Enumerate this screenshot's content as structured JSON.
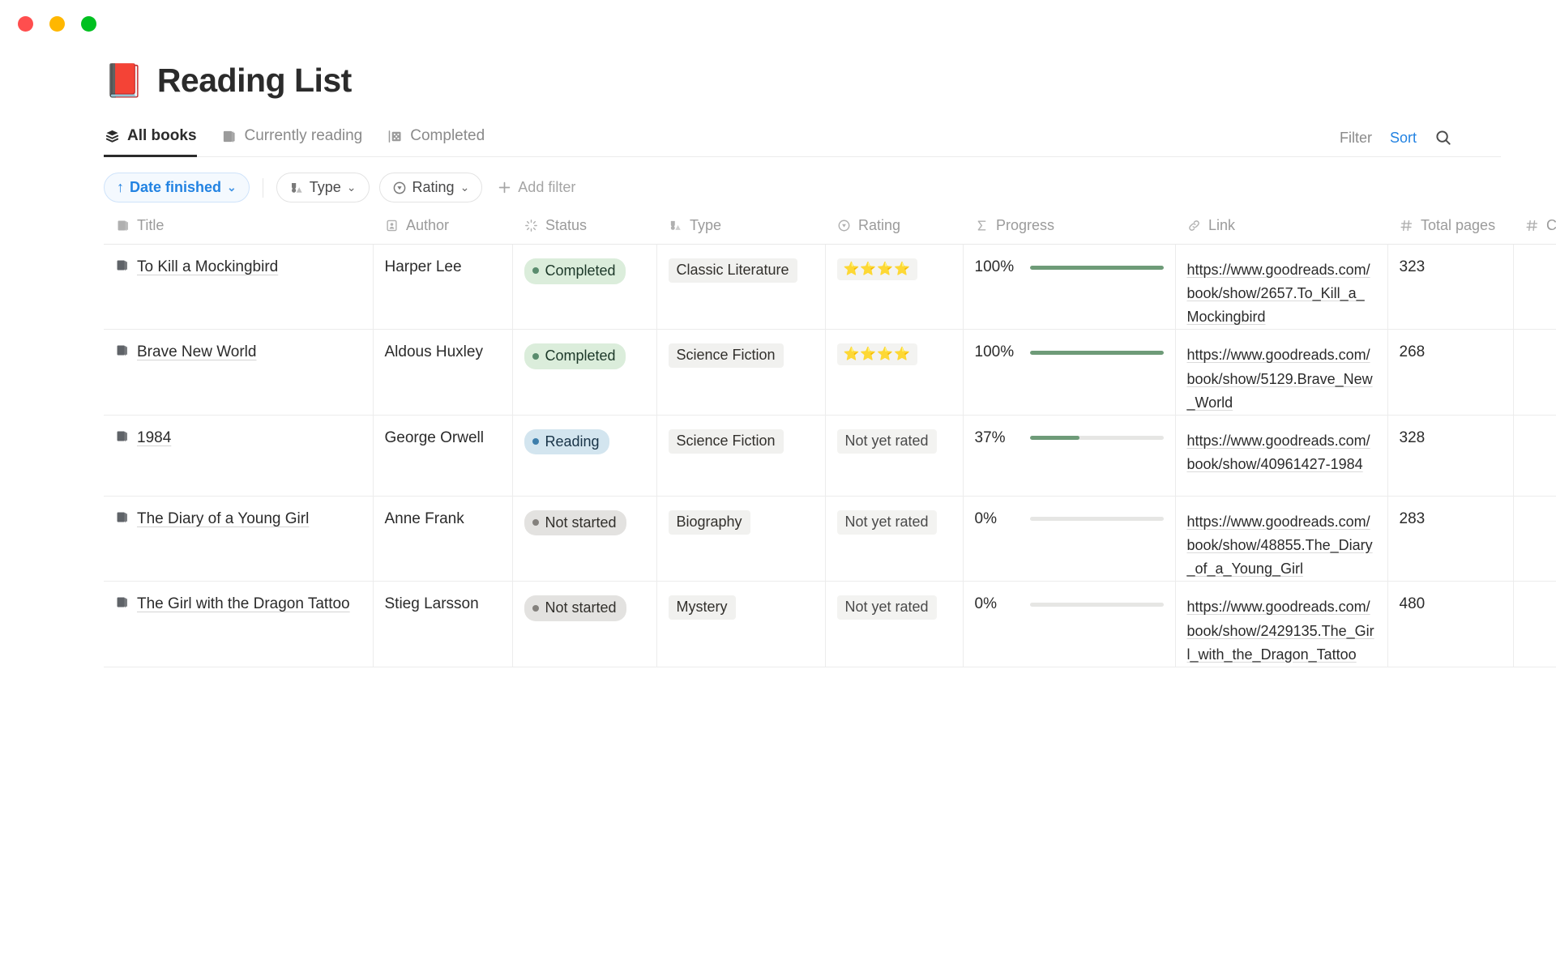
{
  "window": {
    "traffic_lights": [
      "close",
      "minimize",
      "maximize"
    ],
    "colors": {
      "close": "#FF4E4E",
      "minimize": "#FFB700",
      "maximize": "#00C020"
    }
  },
  "header": {
    "emoji": "📕",
    "title": "Reading List"
  },
  "tabs": [
    {
      "label": "All books",
      "icon": "layers-icon",
      "active": true
    },
    {
      "label": "Currently reading",
      "icon": "book-icon",
      "active": false
    },
    {
      "label": "Completed",
      "icon": "gallery-icon",
      "active": false
    }
  ],
  "tabbar_right": {
    "filter_label": "Filter",
    "sort_label": "Sort",
    "sort_color": "#2383e2",
    "search_icon": "search-icon"
  },
  "filters": {
    "sort_chip": {
      "label": "Date finished",
      "direction": "↑",
      "caret": "⌄",
      "active": true,
      "accent": "#2383e2"
    },
    "chips": [
      {
        "label": "Type",
        "icon": "type-icon",
        "caret": "⌄"
      },
      {
        "label": "Rating",
        "icon": "rating-icon",
        "caret": "⌄"
      }
    ],
    "add_filter_label": "Add filter",
    "add_filter_icon": "plus-icon"
  },
  "table": {
    "columns": [
      {
        "key": "title",
        "label": "Title",
        "icon": "book-icon",
        "align": "left"
      },
      {
        "key": "author",
        "label": "Author",
        "icon": "person-icon",
        "align": "left"
      },
      {
        "key": "status",
        "label": "Status",
        "icon": "status-icon",
        "align": "left"
      },
      {
        "key": "type",
        "label": "Type",
        "icon": "type-icon",
        "align": "left"
      },
      {
        "key": "rating",
        "label": "Rating",
        "icon": "rating-icon",
        "align": "left"
      },
      {
        "key": "progress",
        "label": "Progress",
        "icon": "sigma-icon",
        "align": "left"
      },
      {
        "key": "link",
        "label": "Link",
        "icon": "link-icon",
        "align": "left"
      },
      {
        "key": "total_pages",
        "label": "Total pages",
        "icon": "number-icon",
        "align": "right"
      },
      {
        "key": "clipped",
        "label": "C",
        "icon": "number-icon",
        "align": "right"
      }
    ],
    "rows": [
      {
        "title": "To Kill a Mockingbird",
        "author": "Harper Lee",
        "status": {
          "label": "Completed",
          "tone": "green"
        },
        "type": "Classic Literature",
        "rating": {
          "stars": 4,
          "text": "⭐⭐⭐⭐",
          "rated": true
        },
        "progress": {
          "percent": 100,
          "label": "100%"
        },
        "link": "https://www.goodreads.com/book/show/2657.To_Kill_a_Mockingbird",
        "total_pages": "323"
      },
      {
        "title": "Brave New World",
        "author": "Aldous Huxley",
        "status": {
          "label": "Completed",
          "tone": "green"
        },
        "type": "Science Fiction",
        "rating": {
          "stars": 4,
          "text": "⭐⭐⭐⭐",
          "rated": true
        },
        "progress": {
          "percent": 100,
          "label": "100%"
        },
        "link": "https://www.goodreads.com/book/show/5129.Brave_New_World",
        "total_pages": "268"
      },
      {
        "title": "1984",
        "author": "George Orwell",
        "status": {
          "label": "Reading",
          "tone": "blue"
        },
        "type": "Science Fiction",
        "rating": {
          "stars": 0,
          "text": "Not yet rated",
          "rated": false
        },
        "progress": {
          "percent": 37,
          "label": "37%"
        },
        "link": "https://www.goodreads.com/book/show/40961427-1984",
        "total_pages": "328"
      },
      {
        "title": "The Diary of a Young Girl",
        "author": "Anne Frank",
        "status": {
          "label": "Not started",
          "tone": "gray"
        },
        "type": "Biography",
        "rating": {
          "stars": 0,
          "text": "Not yet rated",
          "rated": false
        },
        "progress": {
          "percent": 0,
          "label": "0%"
        },
        "link": "https://www.goodreads.com/book/show/48855.The_Diary_of_a_Young_Girl",
        "total_pages": "283"
      },
      {
        "title": "The Girl with the Dragon Tattoo",
        "author": "Stieg Larsson",
        "status": {
          "label": "Not started",
          "tone": "gray"
        },
        "type": "Mystery",
        "rating": {
          "stars": 0,
          "text": "Not yet rated",
          "rated": false
        },
        "progress": {
          "percent": 0,
          "label": "0%"
        },
        "link": "https://www.goodreads.com/book/show/2429135.The_Girl_with_the_Dragon_Tattoo",
        "total_pages": "480"
      }
    ]
  }
}
